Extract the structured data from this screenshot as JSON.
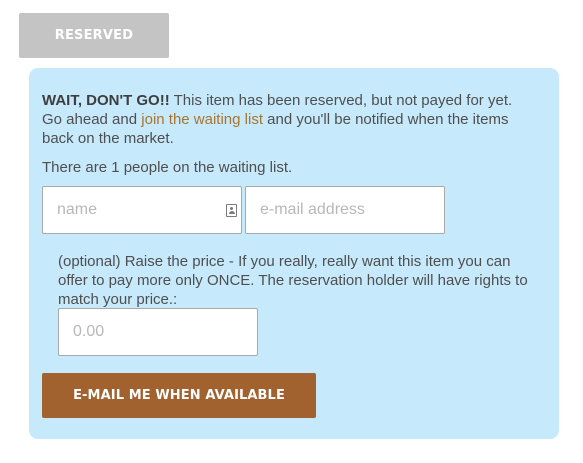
{
  "reserved_button": {
    "label": "RESERVED"
  },
  "waitlist": {
    "headline": "WAIT, DON'T GO!!",
    "message_part1": " This item has been reserved, but not payed for yet. Go ahead and ",
    "link_text": "join the waiting list",
    "message_part2": " and you'll be notified when the items back on the market.",
    "count_text": "There are 1 people on the waiting list.",
    "name_placeholder": "name",
    "email_placeholder": "e-mail address",
    "optional_text": "(optional) Raise the price - If you really, really want this item you can offer to pay more only ONCE. The reservation holder will have rights to match your price.:",
    "price_placeholder": "0.00",
    "submit_label": "E-MAIL ME WHEN AVAILABLE"
  },
  "icons": {
    "name_field_icon": "contact-card-icon"
  },
  "colors": {
    "panel_background": "#c6e9fb",
    "reserved_button": "#c4c4c4",
    "submit_button": "#a1622f",
    "link": "#a9752f"
  }
}
